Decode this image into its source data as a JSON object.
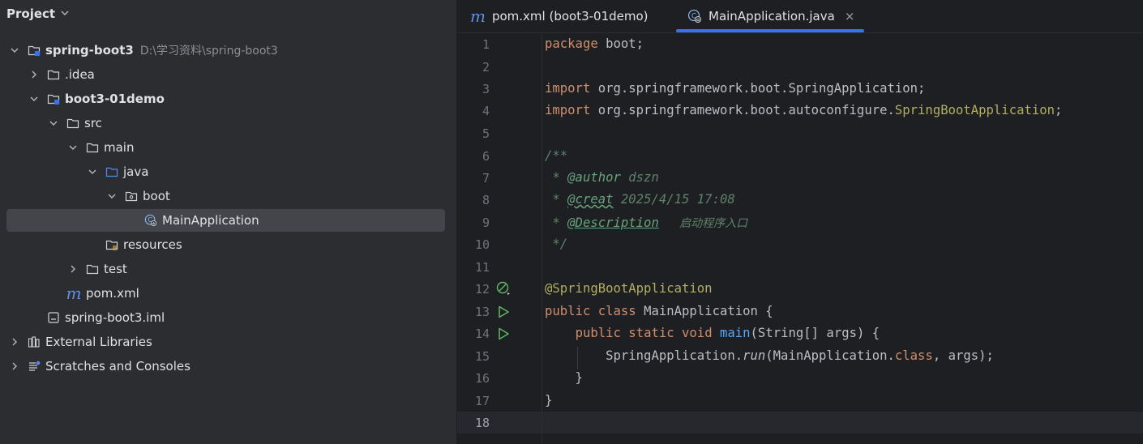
{
  "sidebar": {
    "title": "Project",
    "tree": [
      {
        "label": "spring-boot3",
        "path": "D:\\学习资料\\spring-boot3"
      },
      {
        "label": ".idea"
      },
      {
        "label": "boot3-01demo"
      },
      {
        "label": "src"
      },
      {
        "label": "main"
      },
      {
        "label": "java"
      },
      {
        "label": "boot"
      },
      {
        "label": "MainApplication"
      },
      {
        "label": "resources"
      },
      {
        "label": "test"
      },
      {
        "label": "pom.xml"
      },
      {
        "label": "spring-boot3.iml"
      },
      {
        "label": "External Libraries"
      },
      {
        "label": "Scratches and Consoles"
      }
    ]
  },
  "editor": {
    "tabs": [
      {
        "icon_text": "m",
        "label": "pom.xml (boot3-01demo)"
      },
      {
        "label": "MainApplication.java",
        "close": "×"
      }
    ],
    "line_numbers": [
      "1",
      "2",
      "3",
      "4",
      "5",
      "6",
      "7",
      "8",
      "9",
      "10",
      "11",
      "12",
      "13",
      "14",
      "15",
      "16",
      "17",
      "18"
    ],
    "code": {
      "l1_kw": "package",
      "l1_rest": " boot;",
      "l3_kw": "import",
      "l3_rest": " org.springframework.boot.SpringApplication;",
      "l4_kw": "import",
      "l4_mid": " org.springframework.boot.autoconfigure.",
      "l4_ann": "SpringBootApplication",
      "l4_end": ";",
      "l6": "/**",
      "l7_star": " * ",
      "l7_tag": "@author",
      "l7_val": " dszn",
      "l8_star": " * ",
      "l8_tag": "@creat",
      "l8_val": " 2025/4/15 17:08",
      "l9_star": " * ",
      "l9_tag": "@Description",
      "l9_val": "   启动程序入口",
      "l10": " */",
      "l12": "@SpringBootApplication",
      "l13_kw1": "public",
      "l13_sp": " ",
      "l13_kw2": "class",
      "l13_rest": " MainApplication {",
      "l14_indent": "    ",
      "l14_kw1": "public",
      "l14_kw2": "static",
      "l14_kw3": "void",
      "l14_fn": "main",
      "l14_rest": "(String[] args) {",
      "l15_indent": "        ",
      "l15_a": "SpringApplication.",
      "l15_run": "run",
      "l15_b": "(MainApplication.",
      "l15_kw": "class",
      "l15_c": ", args);",
      "l16": "    }",
      "l17": "}"
    }
  },
  "colors": {
    "background": "#1e1f22",
    "sidebar": "#2b2d30",
    "accent": "#3574f0",
    "keyword": "#cf8e6d",
    "annotation": "#b3ae60",
    "doc_comment": "#5f826b",
    "function": "#56a8f5"
  },
  "icons": [
    "chevron-down-icon",
    "chevron-right-icon",
    "module-folder-icon",
    "folder-icon",
    "source-folder-icon",
    "package-icon",
    "spring-class-icon",
    "resources-folder-icon",
    "maven-icon",
    "iml-file-icon",
    "libraries-icon",
    "scratches-icon",
    "run-icon",
    "spring-bean-icon",
    "close-icon"
  ]
}
